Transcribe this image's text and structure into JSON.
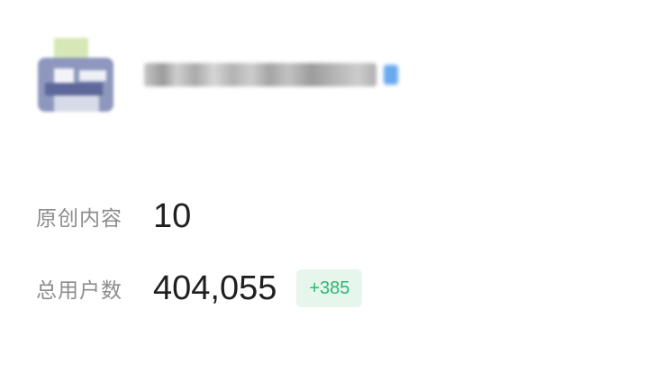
{
  "profile": {
    "avatar_icon": "account-avatar-icon",
    "name_redacted": true
  },
  "stats": [
    {
      "label": "原创内容",
      "value": "10"
    },
    {
      "label": "总用户数",
      "value": "404,055",
      "delta": "+385"
    }
  ],
  "colors": {
    "label": "#8c8c8c",
    "value": "#1f1f1f",
    "delta_text": "#2bb673",
    "delta_bg": "#e6f6ec"
  }
}
